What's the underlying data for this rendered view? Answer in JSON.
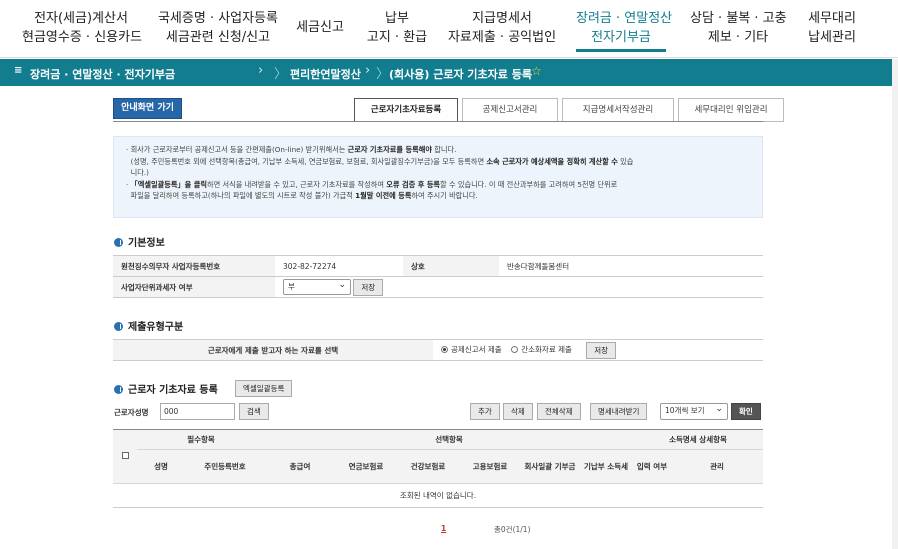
{
  "topnav": {
    "items": [
      {
        "line1": "전자(세금)계산서",
        "line2": "현금영수증 · 신용카드"
      },
      {
        "line1": "국세증명 · 사업자등록",
        "line2": "세금관련 신청/신고"
      },
      {
        "line1": "세금신고",
        "line2": ""
      },
      {
        "line1": "납부",
        "line2": "고지 · 환급"
      },
      {
        "line1": "지급명세서",
        "line2": "자료제출 · 공익법인"
      },
      {
        "line1": "장려금 · 연말정산",
        "line2": "전자기부금"
      },
      {
        "line1": "상담 · 불복 · 고충",
        "line2": "제보 · 기타"
      },
      {
        "line1": "세무대리",
        "line2": "납세관리"
      }
    ]
  },
  "subbar": {
    "menu": "장려금 · 연말정산 · 전자기부금",
    "crumb1": "편리한연말정산",
    "crumb2": "(회사용) 근로자 기초자료 등록",
    "star": "☆"
  },
  "guide_button": "안내화면 가기",
  "tabs": [
    "근로자기초자료등록",
    "공제신고서관리",
    "지급명세서작성관리",
    "세무대리인 위임관리"
  ],
  "notice": {
    "l1a": "· 회사가 근로자로부터 공제신고서 등을 간편제출(On-line) 받기위해서는 ",
    "l1b": "근로자 기초자료를 등록해야",
    "l1c": " 합니다.",
    "l2a": "(성명, 주민등록번호 외에 선택항목(총급여, 기납부 소득세, 연금보험료, 보험료, 회사일괄징수기부금)을 모두 등록하면 ",
    "l2b": "소속 근로자가 예상세액을 정확히 계산할 수",
    "l2c": " 있습",
    "l3": "니다.)",
    "l4a": "· ",
    "l4b": "「엑셀일괄등록」을 클릭",
    "l4c": "하면 서식을 내려받을 수 있고, 근로자 기초자료를 작성하여 ",
    "l4d": "오류 검증 후 등록",
    "l4e": "할 수 있습니다. 이 때 전산과부하를 고려하여 5천명 단위로",
    "l5a": "파일을 달리하여 등록하고(하나의 파일에 별도의 시트로 작성 불가) 가급적 ",
    "l5b": "1월말 이전에 등록",
    "l5c": "하여 주시기 바랍니다."
  },
  "basic": {
    "title": "기본정보",
    "bizno_label": "원천징수의무자 사업자등록번호",
    "bizno": "302-82-72274",
    "company_label": "상호",
    "company": "반송다함께돌봄센터",
    "unit_label": "사업자단위과세자 여부",
    "unit_value": "부",
    "save": "저장"
  },
  "submit": {
    "title": "제출유형구분",
    "label": "근로자에게 제출 받고자 하는 자료를 선택",
    "opt1": "공제신고서 제출",
    "opt2": "간소화자료 제출",
    "save": "저장"
  },
  "emp": {
    "title": "근로자 기초자료 등록",
    "excel": "엑셀일괄등록",
    "name_label": "근로자성명",
    "name_value": "000",
    "search": "검색",
    "add": "추가",
    "delete": "삭제",
    "delete_all": "전체삭제",
    "download": "명세내려받기",
    "page_size": "10개씩 보기",
    "confirm": "확인"
  },
  "grid": {
    "group1": "필수항목",
    "group2": "선택항목",
    "group3": "소득명세 상세항목",
    "cols": [
      "성명",
      "주민등록번호",
      "총급여",
      "연금보험료",
      "건강보험료",
      "고용보험료",
      "회사일괄 기부금",
      "기납부 소득세",
      "입력 여부",
      "관리"
    ],
    "empty": "조회된 내역이 없습니다."
  },
  "pager": {
    "page": "1",
    "total": "총0건(1/1)"
  },
  "colors": {
    "brand": "#127d8e",
    "button_blue": "#2767a7"
  }
}
